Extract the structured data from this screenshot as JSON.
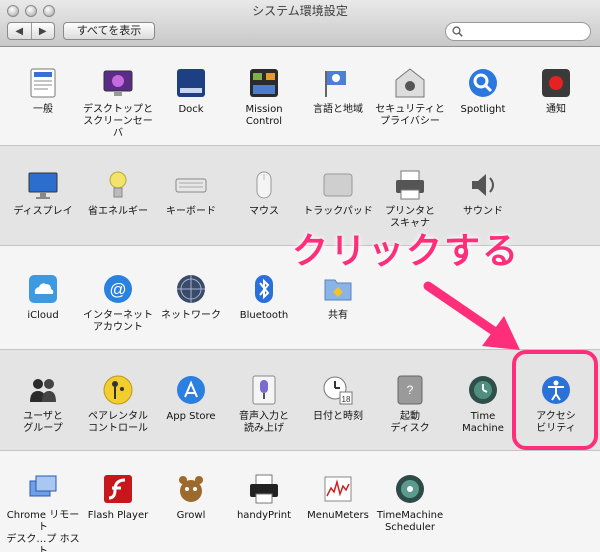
{
  "window": {
    "title": "システム環境設定",
    "back_label": "◀",
    "forward_label": "▶",
    "show_all_label": "すべてを表示",
    "search_placeholder": ""
  },
  "sections": [
    {
      "items": [
        {
          "label": "一般",
          "icon": "general-icon"
        },
        {
          "label": "デスクトップと\nスクリーンセーバ",
          "icon": "desktop-screensaver-icon"
        },
        {
          "label": "Dock",
          "icon": "dock-icon"
        },
        {
          "label": "Mission\nControl",
          "icon": "mission-control-icon"
        },
        {
          "label": "言語と地域",
          "icon": "language-region-icon"
        },
        {
          "label": "セキュリティと\nプライバシー",
          "icon": "security-privacy-icon"
        },
        {
          "label": "Spotlight",
          "icon": "spotlight-icon"
        },
        {
          "label": "通知",
          "icon": "notifications-icon"
        }
      ]
    },
    {
      "items": [
        {
          "label": "ディスプレイ",
          "icon": "display-icon"
        },
        {
          "label": "省エネルギー",
          "icon": "energy-saver-icon"
        },
        {
          "label": "キーボード",
          "icon": "keyboard-icon"
        },
        {
          "label": "マウス",
          "icon": "mouse-icon"
        },
        {
          "label": "トラックパッド",
          "icon": "trackpad-icon"
        },
        {
          "label": "プリンタと\nスキャナ",
          "icon": "printer-scanner-icon"
        },
        {
          "label": "サウンド",
          "icon": "sound-icon"
        }
      ]
    },
    {
      "items": [
        {
          "label": "iCloud",
          "icon": "icloud-icon"
        },
        {
          "label": "インターネット\nアカウント",
          "icon": "internet-accounts-icon"
        },
        {
          "label": "ネットワーク",
          "icon": "network-icon"
        },
        {
          "label": "Bluetooth",
          "icon": "bluetooth-icon"
        },
        {
          "label": "共有",
          "icon": "sharing-icon"
        }
      ]
    },
    {
      "items": [
        {
          "label": "ユーザと\nグループ",
          "icon": "users-groups-icon"
        },
        {
          "label": "ペアレンタル\nコントロール",
          "icon": "parental-controls-icon"
        },
        {
          "label": "App Store",
          "icon": "app-store-icon"
        },
        {
          "label": "音声入力と\n読み上げ",
          "icon": "dictation-speech-icon"
        },
        {
          "label": "日付と時刻",
          "icon": "date-time-icon"
        },
        {
          "label": "起動\nディスク",
          "icon": "startup-disk-icon"
        },
        {
          "label": "Time\nMachine",
          "icon": "time-machine-icon"
        },
        {
          "label": "アクセシ\nビリティ",
          "icon": "accessibility-icon"
        }
      ]
    },
    {
      "items": [
        {
          "label": "Chrome リモート\nデスク…プ ホスト",
          "icon": "chrome-remote-desktop-icon"
        },
        {
          "label": "Flash Player",
          "icon": "flash-player-icon"
        },
        {
          "label": "Growl",
          "icon": "growl-icon"
        },
        {
          "label": "handyPrint",
          "icon": "handyprint-icon"
        },
        {
          "label": "MenuMeters",
          "icon": "menumeters-icon"
        },
        {
          "label": "TimeMachine\nScheduler",
          "icon": "timemachine-scheduler-icon"
        }
      ]
    }
  ],
  "annotation": {
    "text": "クリックする",
    "color": "#ff2e7a"
  }
}
